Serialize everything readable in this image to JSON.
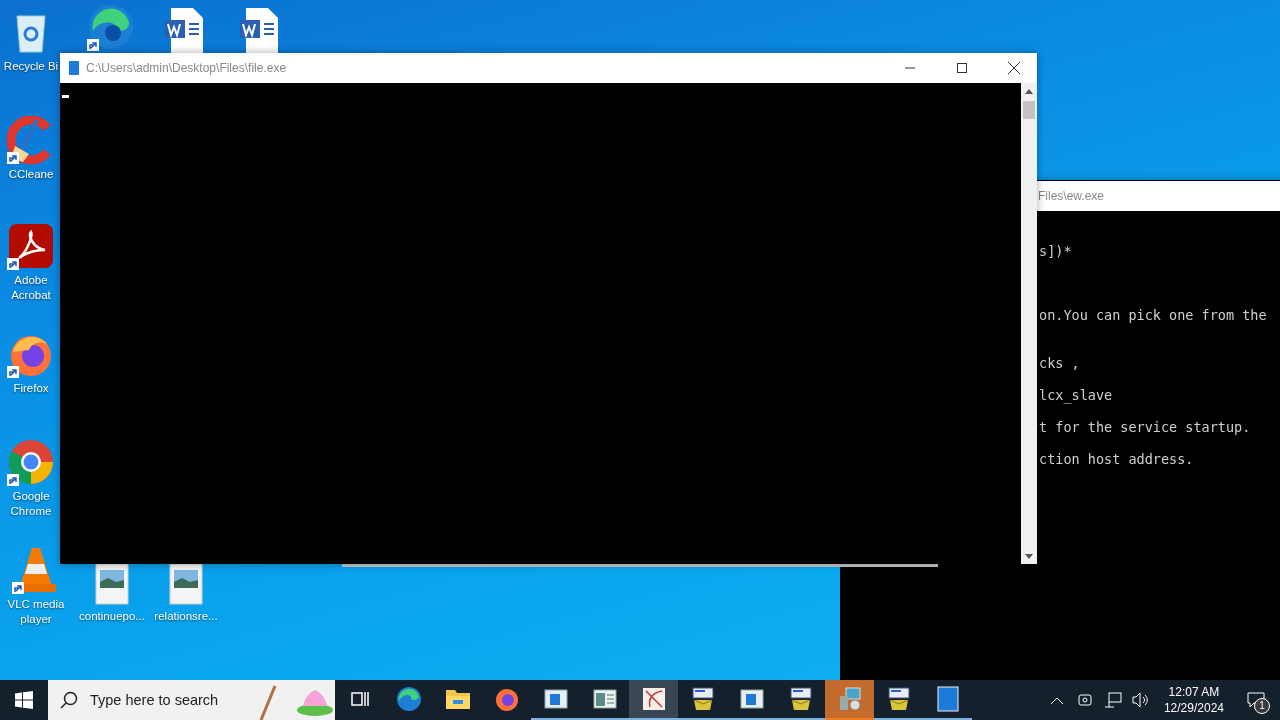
{
  "desktop_icons": [
    {
      "kind": "recycle",
      "label": "Recycle Bi",
      "shortcut": false
    },
    {
      "kind": "edge",
      "shortcut": true
    },
    {
      "kind": "word",
      "shortcut": false
    },
    {
      "kind": "word",
      "shortcut": false
    },
    {
      "kind": "ccleaner",
      "label": "CCleane",
      "shortcut": true
    },
    {
      "kind": "acrobat",
      "label": "Adobe Acrobat",
      "shortcut": true
    },
    {
      "kind": "firefox",
      "label": "Firefox",
      "shortcut": true
    },
    {
      "kind": "chrome",
      "label": "Google Chrome",
      "shortcut": true
    },
    {
      "kind": "vlc",
      "label": "VLC media player",
      "shortcut": true
    },
    {
      "kind": "image",
      "label": "continuepo...",
      "shortcut": false
    },
    {
      "kind": "image",
      "label": "relationsre...",
      "shortcut": false
    }
  ],
  "back_window": {
    "title": "Files\\ew.exe",
    "lines": [
      "s])*",
      "on.You can pick one from the",
      "cks ,",
      "lcx_slave",
      "t for the service startup.",
      "ction host address."
    ]
  },
  "front_window": {
    "title": "C:\\Users\\admin\\Desktop\\Files\\file.exe"
  },
  "taskbar": {
    "search": {
      "placeholder": "Type here to search"
    },
    "apps": [
      {
        "kind": "taskview",
        "running": false,
        "selected": false
      },
      {
        "kind": "edge",
        "running": false,
        "selected": false
      },
      {
        "kind": "explorer",
        "running": false,
        "selected": false
      },
      {
        "kind": "firefox",
        "running": false,
        "selected": false
      },
      {
        "kind": "console",
        "running": true,
        "selected": false
      },
      {
        "kind": "notepad",
        "running": true,
        "selected": false
      },
      {
        "kind": "paint",
        "running": true,
        "selected": true
      },
      {
        "kind": "installer",
        "running": true,
        "selected": false
      },
      {
        "kind": "console",
        "running": true,
        "selected": false
      },
      {
        "kind": "installer",
        "running": true,
        "selected": false
      },
      {
        "kind": "setup",
        "running": true,
        "selected": false,
        "attention": true
      },
      {
        "kind": "installer",
        "running": true,
        "selected": false
      },
      {
        "kind": "document",
        "running": true,
        "selected": false
      }
    ],
    "time": "12:07 AM",
    "date": "12/29/2024",
    "notification_count": "1"
  }
}
